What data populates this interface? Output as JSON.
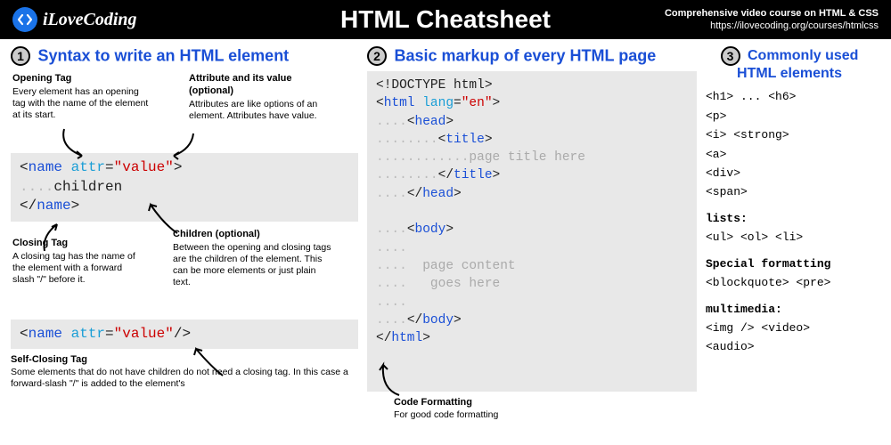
{
  "header": {
    "brand": "iLoveCoding",
    "title": "HTML Cheatsheet",
    "sub1": "Comprehensive video course on HTML & CSS",
    "sub2": "https://ilovecoding.org/courses/htmlcss"
  },
  "s1": {
    "title": "Syntax to write an HTML element",
    "open_h": "Opening Tag",
    "open_t": "Every element has an opening tag with the name of the element at its start.",
    "attr_h": "Attribute and its value (optional)",
    "attr_t": "Attributes are like options of an element. Attributes have value.",
    "close_h": "Closing Tag",
    "close_t": "A closing tag has the name of the element with a forward slash \"/\" before it.",
    "child_h": "Children (optional)",
    "child_t": "Between the opening and closing tags are the children of the element. This can be more elements or just plain text.",
    "self_h": "Self-Closing Tag",
    "self_t": "Some elements that do not have children do not need a closing tag. In this case a forward-slash \"/\" is added to the element's"
  },
  "s2": {
    "title": "Basic markup of every HTML page",
    "cf_h": "Code Formatting",
    "cf_t": "For good code formatting"
  },
  "s3": {
    "title": "Commonly used HTML elements",
    "l1": "<h1> ... <h6>",
    "l2": "<p>",
    "l3": "<i> <strong>",
    "l4": "<a>",
    "l5": "<div>",
    "l6": "<span>",
    "lh": "lists:",
    "l7": "<ul> <ol> <li>",
    "sh": "Special formatting",
    "l8": "<blockquote> <pre>",
    "mh": "multimedia:",
    "l9": "<img /> <video>",
    "l10": "<audio>"
  }
}
